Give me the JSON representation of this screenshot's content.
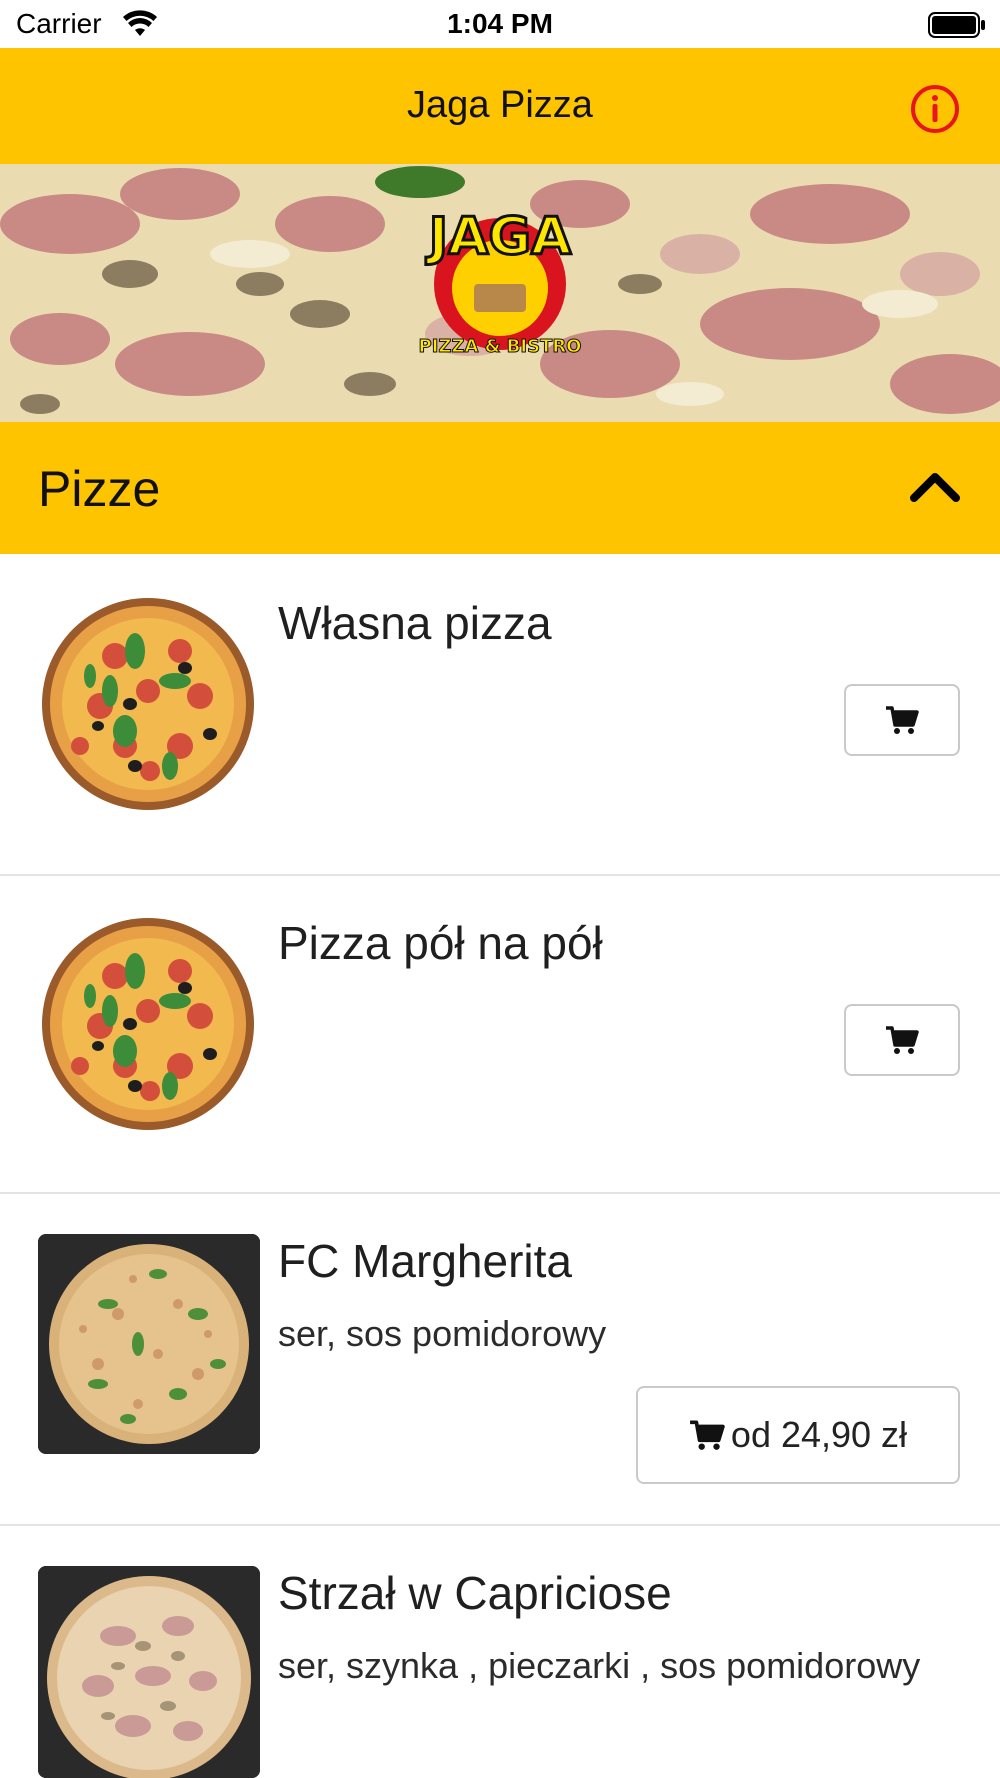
{
  "status_bar": {
    "carrier": "Carrier",
    "time": "1:04 PM"
  },
  "nav": {
    "title": "Jaga Pizza",
    "info_icon": "info-circle-icon"
  },
  "hero": {
    "logo_text": "JAGA",
    "logo_subtext": "PIZZA & BISTRO"
  },
  "section": {
    "title": "Pizze",
    "toggle_icon": "chevron-up-icon"
  },
  "items": [
    {
      "name": "Własna pizza",
      "description": "",
      "price": ""
    },
    {
      "name": "Pizza pół na pół",
      "description": "",
      "price": ""
    },
    {
      "name": "FC Margherita",
      "description": " ser, sos pomidorowy",
      "price": "od 24,90 zł"
    },
    {
      "name": "Strzał w Capriciose",
      "description": " ser, szynka , pieczarki , sos pomidorowy",
      "price": ""
    }
  ],
  "colors": {
    "accent": "#ffc400",
    "info_red": "#e8141e",
    "divider": "#e3e3e3"
  }
}
